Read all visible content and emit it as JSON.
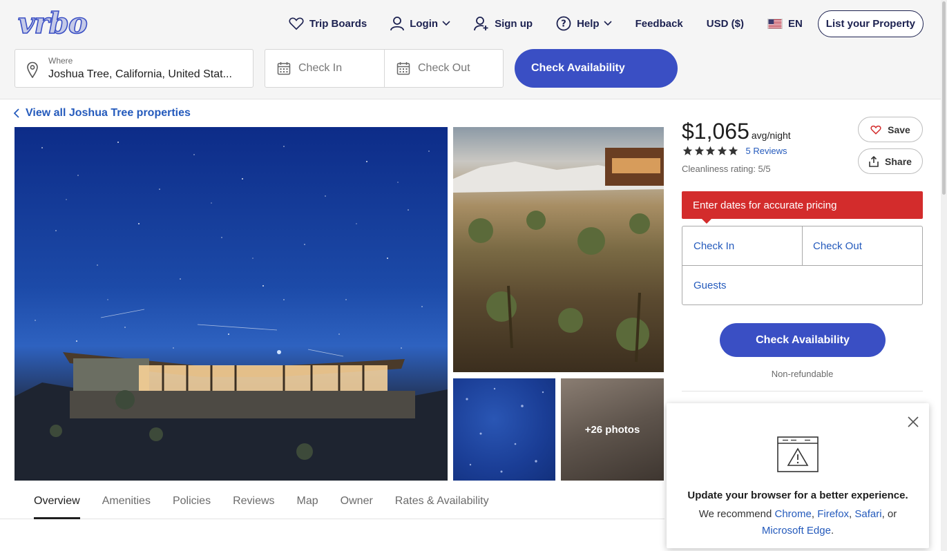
{
  "brand": {
    "logo_text": "Vrbo",
    "color": "#3a4fc4"
  },
  "nav": {
    "trip_boards": "Trip Boards",
    "login": "Login",
    "signup": "Sign up",
    "help": "Help",
    "feedback": "Feedback",
    "currency": "USD ($)",
    "language": "EN",
    "list_property": "List your Property"
  },
  "search": {
    "where_label": "Where",
    "where_value": "Joshua Tree, California, United Stat...",
    "check_in": "Check In",
    "check_out": "Check Out",
    "button": "Check Availability"
  },
  "back_link": "View all Joshua Tree properties",
  "gallery": {
    "more_photos": "+26 photos"
  },
  "tabs": [
    "Overview",
    "Amenities",
    "Policies",
    "Reviews",
    "Map",
    "Owner",
    "Rates & Availability"
  ],
  "pricing": {
    "price": "$1,065",
    "unit": "avg/night",
    "rating_stars": 5,
    "reviews": "5 Reviews",
    "cleanliness": "Cleanliness rating: 5/5",
    "save": "Save",
    "share": "Share",
    "alert": "Enter dates for accurate pricing",
    "check_in": "Check In",
    "check_out": "Check Out",
    "guests": "Guests",
    "button": "Check Availability",
    "refund_policy": "Non-refundable"
  },
  "browser_popup": {
    "title": "Update your browser for a better experience.",
    "recommend": "We recommend",
    "chrome": "Chrome",
    "firefox": "Firefox",
    "safari": "Safari",
    "or": "or",
    "edge": "Microsoft Edge"
  },
  "colors": {
    "alert": "#d32c2c",
    "link": "#245abc",
    "nav_text": "#1c2150",
    "button": "#3a4fc4"
  }
}
